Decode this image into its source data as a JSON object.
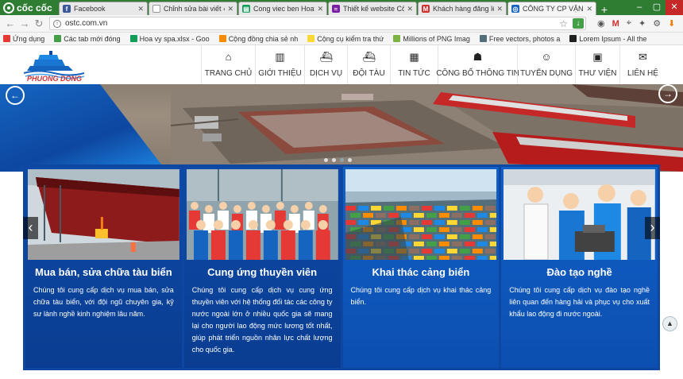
{
  "browser": {
    "brand": "cốc cốc",
    "tabs": [
      {
        "title": "Facebook",
        "icon": "facebook-icon",
        "color": "#3b5998",
        "glyph": "f"
      },
      {
        "title": "Chỉnh sửa bài viết ‹ T",
        "icon": "document-icon",
        "color": "#ffffff",
        "glyph": ""
      },
      {
        "title": "Cong viec ben Hoavy",
        "icon": "sheets-icon",
        "color": "#0f9d58",
        "glyph": "▤"
      },
      {
        "title": "Thiết kế website Côn",
        "icon": "wave-icon",
        "color": "#7b1fa2",
        "glyph": "≈"
      },
      {
        "title": "Khách hàng đăng lên",
        "icon": "gmail-icon",
        "color": "#d32f2f",
        "glyph": "M"
      },
      {
        "title": "CÔNG TY CP VẬN TẢI",
        "icon": "site-icon",
        "color": "#1565c0",
        "glyph": "◎"
      }
    ],
    "url": "ostc.com.vn",
    "bookmarks": [
      {
        "label": "Ứng dụng",
        "color": "#e53935"
      },
      {
        "label": "Các tab mới đóng",
        "color": "#43a047"
      },
      {
        "label": "Hoa vy spa.xlsx - Goo",
        "color": "#0f9d58"
      },
      {
        "label": "Cộng đồng chia sẻ nh",
        "color": "#fb8c00"
      },
      {
        "label": "Cộng cụ kiểm tra thứ",
        "color": "#fdd835"
      },
      {
        "label": "Millions of PNG Imag",
        "color": "#7cb342"
      },
      {
        "label": "Free vectors, photos a",
        "color": "#546e7a"
      },
      {
        "label": "Lorem Ipsum - All the",
        "color": "#212121"
      }
    ]
  },
  "site": {
    "logo_text": "PHUONG DONG",
    "nav": [
      {
        "label": "Trang chủ",
        "icon": "home-icon",
        "glyph": "⌂",
        "width": 68
      },
      {
        "label": "Giới thiệu",
        "icon": "book-icon",
        "glyph": "▥",
        "width": 62
      },
      {
        "label": "Dịch vụ",
        "icon": "ship-icon",
        "glyph": "⛴",
        "width": 54
      },
      {
        "label": "Đội tàu",
        "icon": "ship-icon",
        "glyph": "⛴",
        "width": 54
      },
      {
        "label": "Tin tức",
        "icon": "newspaper-icon",
        "glyph": "▦",
        "width": 60
      },
      {
        "label": "Công bố thông tin",
        "icon": "group-icon",
        "glyph": "☗",
        "width": 100
      },
      {
        "label": "Tuyển dụng",
        "icon": "user-icon",
        "glyph": "☺",
        "width": 73
      },
      {
        "label": "Thư viện",
        "icon": "image-icon",
        "glyph": "▣",
        "width": 56
      },
      {
        "label": "Liên hệ",
        "icon": "chat-icon",
        "glyph": "✉",
        "width": 58
      }
    ],
    "services": [
      {
        "title": "Mua bán, sửa chữa tàu biển",
        "desc": "Chúng tôi cung cấp dịch vụ mua bán, sửa chữa tàu biển, với đội ngũ chuyên gia, kỹ sư lành nghề kinh nghiệm lâu năm.",
        "photo": "ship-repair-photo"
      },
      {
        "title": "Cung ứng thuyền viên",
        "desc": "Chúng tôi cung cấp dịch vụ cung ứng thuyền viên với hệ thống đối tác các công ty nước ngoài lớn ở nhiều quốc gia sẽ mang lại cho người lao động mức lương tốt nhất, giúp phát triển nguồn nhân lực chất lượng cho quốc gia.",
        "photo": "crew-photo"
      },
      {
        "title": "Khai thác cảng biển",
        "desc": "Chúng tôi cung cấp dịch vụ khai thác cảng biển.",
        "photo": "seaport-photo"
      },
      {
        "title": "Đào tạo nghề",
        "desc": "Chúng tôi cung cấp dịch vụ đào tạo nghề liên quan đến hàng hải và phục vụ cho xuất khẩu lao động đi nước ngoài.",
        "photo": "training-photo"
      }
    ]
  }
}
